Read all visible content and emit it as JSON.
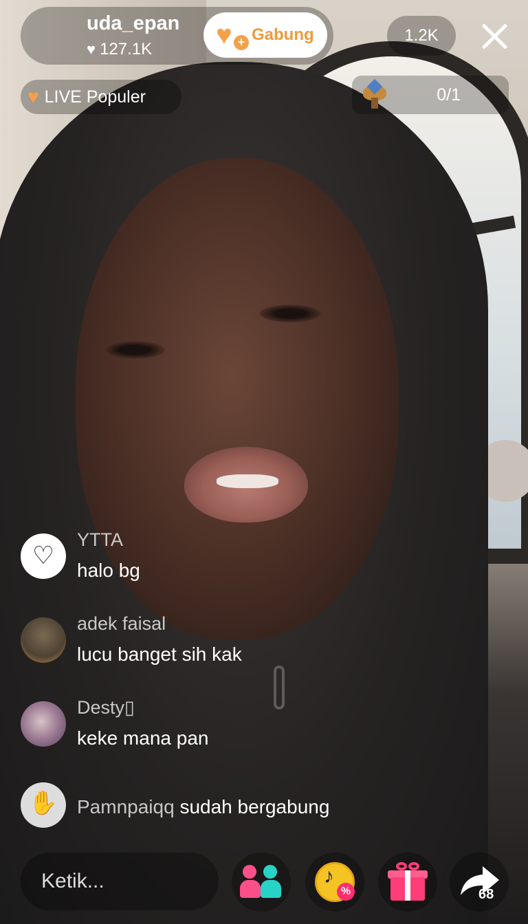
{
  "host": {
    "username": "uda_epan",
    "likes": "127.1K",
    "join_label": "Gabung"
  },
  "viewer_count": "1.2K",
  "popular_badge": "LIVE Populer",
  "rank_counter": "0/1",
  "comments": [
    {
      "username": "YTTA",
      "message": "halo bg"
    },
    {
      "username": "adek faisal",
      "message": "lucu banget sih kak"
    },
    {
      "username": "Desty▯",
      "message": "keke mana pan"
    }
  ],
  "join_notice": {
    "username": "Pamnpaiqq",
    "text": "sudah bergabung"
  },
  "chat_input": {
    "placeholder": "Ketik..."
  },
  "share_count": "68",
  "colors": {
    "accent_orange": "#f29a3a",
    "gift_pink": "#ff3e79",
    "coin_yellow": "#f6c324"
  }
}
